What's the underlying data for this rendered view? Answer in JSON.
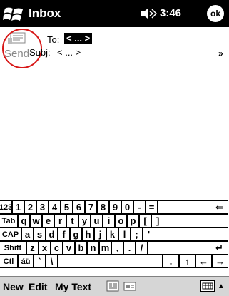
{
  "title_bar": {
    "title": "Inbox",
    "time": "3:46",
    "ok_label": "ok"
  },
  "header": {
    "send_label": "Send",
    "to_label": "To:",
    "to_value": "< ... >",
    "subj_label": "Subj:",
    "subj_value": "< ... >",
    "expand_glyph": "»"
  },
  "keyboard": {
    "rows": [
      [
        "123",
        "1",
        "2",
        "3",
        "4",
        "5",
        "6",
        "7",
        "8",
        "9",
        "0",
        "-",
        "=",
        "⇐"
      ],
      [
        "Tab",
        "q",
        "w",
        "e",
        "r",
        "t",
        "y",
        "u",
        "i",
        "o",
        "p",
        "[",
        "]"
      ],
      [
        "CAP",
        "a",
        "s",
        "d",
        "f",
        "g",
        "h",
        "j",
        "k",
        "l",
        ";",
        "'"
      ],
      [
        "Shift",
        "z",
        "x",
        "c",
        "v",
        "b",
        "n",
        "m",
        ",",
        ".",
        "/",
        "↵"
      ],
      [
        "Ctl",
        "áü",
        "`",
        "\\",
        "",
        "↓",
        "↑",
        "←",
        "→"
      ]
    ]
  },
  "menu_bar": {
    "new_label": "New",
    "edit_label": "Edit",
    "my_text_label": "My Text",
    "input_arrow": "▲"
  },
  "colors": {
    "title_bg": "#000000",
    "highlight_ring": "#d81818",
    "menu_bg": "#d6d6d6"
  }
}
